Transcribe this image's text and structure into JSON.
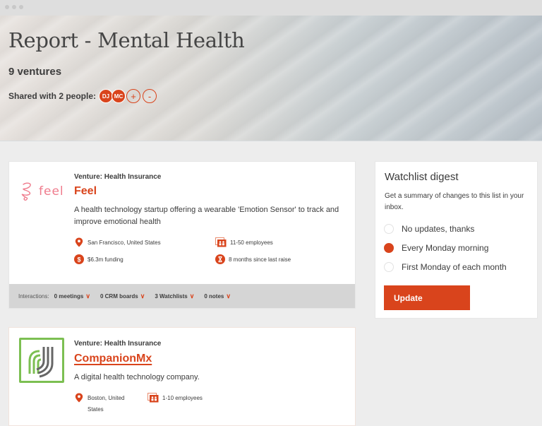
{
  "window": {
    "controls": [
      "close",
      "minimize",
      "maximize"
    ]
  },
  "header": {
    "title": "Report - Mental Health",
    "ventures_count": "9 ventures",
    "shared_label": "Shared with 2 people:",
    "shared_people": [
      {
        "initials": "DJ"
      },
      {
        "initials": "MC"
      }
    ],
    "add_label": "+",
    "remove_label": "-"
  },
  "ventures": [
    {
      "category": "Venture: Health Insurance",
      "name": "Feel",
      "logo_text": "feel",
      "description": "A health technology startup offering a wearable 'Emotion Sensor' to track and improve emotional health",
      "location": "San Francisco, United States",
      "employees": "11-50 employees",
      "funding": "$6.3m funding",
      "last_raise": "8 months since last raise",
      "interactions": {
        "label": "Interactions:",
        "meetings": "0 meetings",
        "crm_boards": "0 CRM boards",
        "watchlists": "3 Watchlists",
        "notes": "0 notes"
      }
    },
    {
      "category": "Venture: Health Insurance",
      "name": "CompanionMx",
      "description": "A digital health technology company.",
      "location": "Boston, United States",
      "employees": "1-10 employees"
    }
  ],
  "digest": {
    "title": "Watchlist digest",
    "description": "Get a summary of changes to this list in your inbox.",
    "options": [
      {
        "label": "No updates, thanks",
        "checked": false
      },
      {
        "label": "Every Monday morning",
        "checked": true
      },
      {
        "label": "First Monday of each month",
        "checked": false
      }
    ],
    "button_label": "Update"
  },
  "colors": {
    "accent": "#d9441c",
    "feel_pink": "#ef7b8c",
    "companion_green": "#7cbf52"
  }
}
